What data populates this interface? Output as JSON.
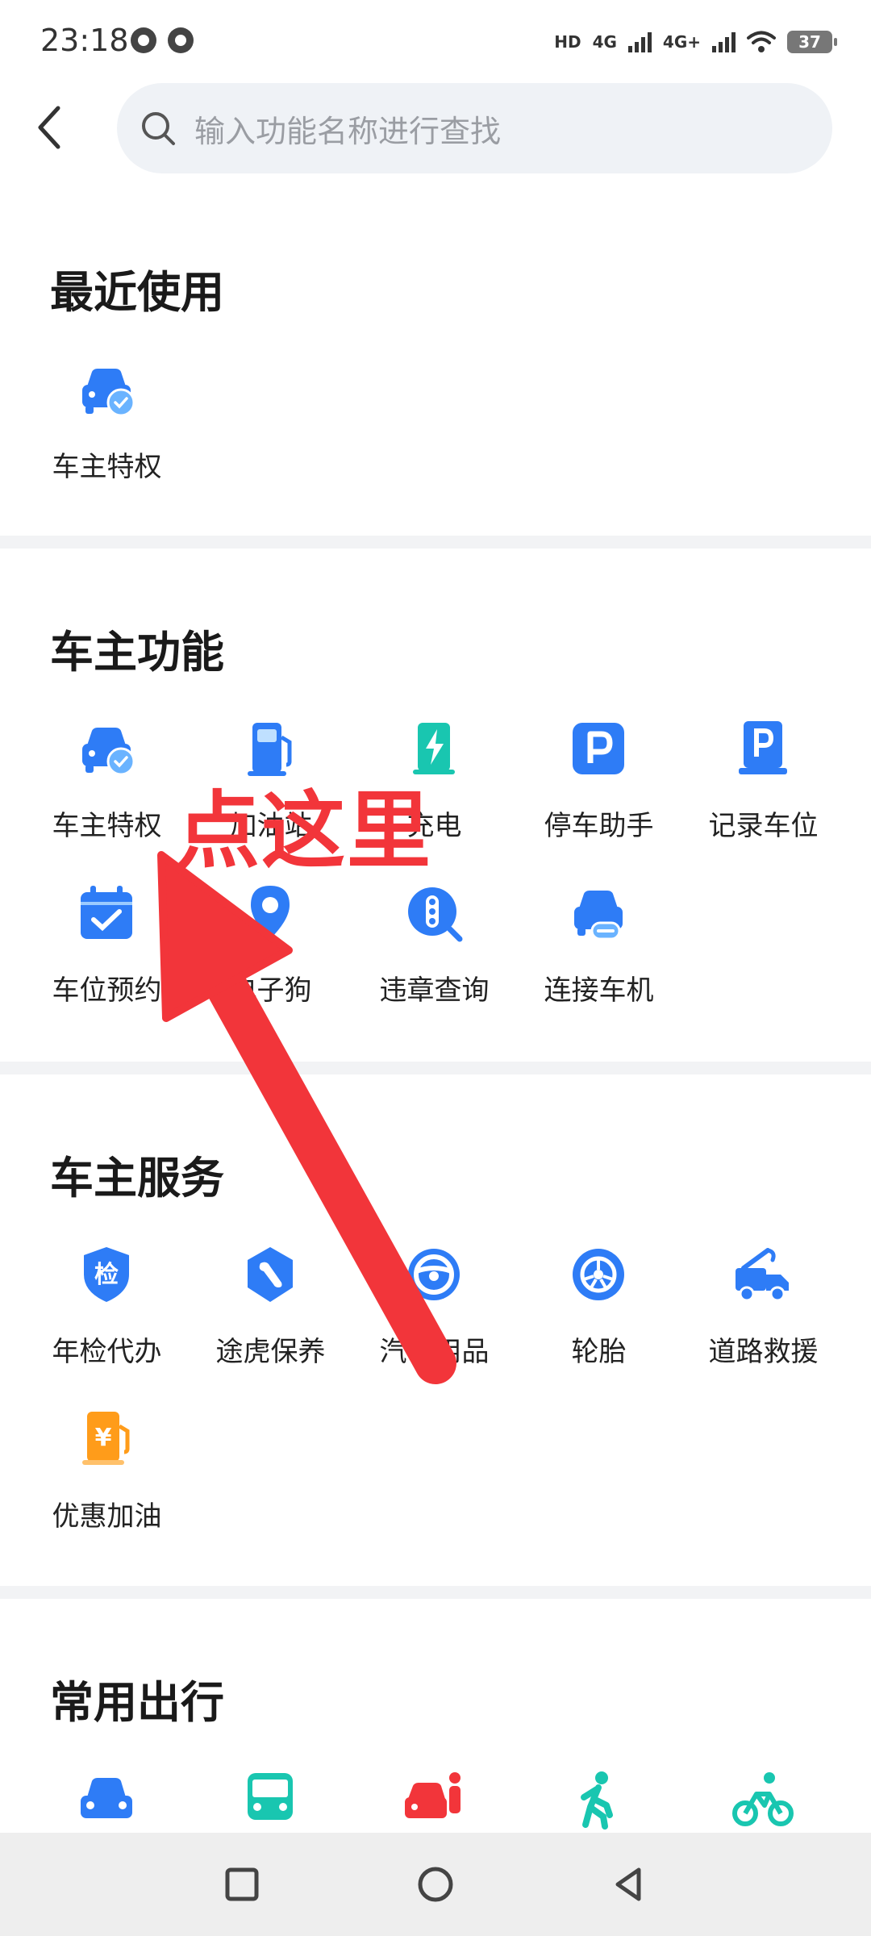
{
  "status_bar": {
    "time": "23:18",
    "hd_label": "HD",
    "net1": "4G",
    "net2": "4G+",
    "battery": "37"
  },
  "search": {
    "placeholder": "输入功能名称进行查找"
  },
  "sections": {
    "recent": {
      "title": "最近使用",
      "items": [
        {
          "label": "车主特权",
          "icon": "car-check-icon"
        }
      ]
    },
    "owner_functions": {
      "title": "车主功能",
      "items": [
        {
          "label": "车主特权",
          "icon": "car-check-icon"
        },
        {
          "label": "加油站",
          "icon": "gas-station-icon"
        },
        {
          "label": "充电",
          "icon": "charging-icon"
        },
        {
          "label": "停车助手",
          "icon": "parking-icon"
        },
        {
          "label": "记录车位",
          "icon": "parking-sign-icon"
        },
        {
          "label": "车位预约",
          "icon": "calendar-check-icon"
        },
        {
          "label": "电子狗",
          "icon": "location-pin-icon"
        },
        {
          "label": "违章查询",
          "icon": "traffic-light-icon"
        },
        {
          "label": "连接车机",
          "icon": "car-link-icon"
        }
      ]
    },
    "owner_services": {
      "title": "车主服务",
      "items": [
        {
          "label": "年检代办",
          "icon": "inspection-shield-icon"
        },
        {
          "label": "途虎保养",
          "icon": "wrench-icon"
        },
        {
          "label": "汽车用品",
          "icon": "steering-wheel-icon"
        },
        {
          "label": "轮胎",
          "icon": "tire-icon"
        },
        {
          "label": "道路救援",
          "icon": "tow-truck-icon"
        },
        {
          "label": "优惠加油",
          "icon": "yuan-fuel-icon"
        }
      ]
    },
    "common_travel": {
      "title": "常用出行",
      "items": [
        {
          "icon": "car-icon"
        },
        {
          "icon": "bus-icon"
        },
        {
          "icon": "taxi-icon"
        },
        {
          "icon": "walking-icon"
        },
        {
          "icon": "cycling-icon"
        }
      ]
    }
  },
  "annotation": {
    "text": "点这里",
    "color": "#f2353a"
  },
  "colors": {
    "primary_blue": "#2e7cf6",
    "teal": "#19c6b0",
    "orange": "#ff9c1a",
    "red": "#f2353a"
  }
}
